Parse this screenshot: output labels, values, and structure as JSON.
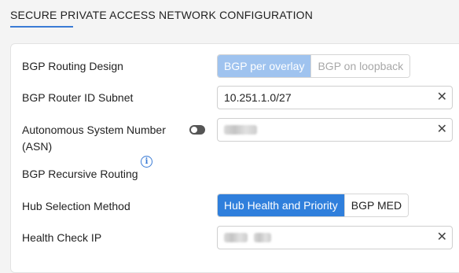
{
  "header": {
    "title": "SECURE PRIVATE ACCESS NETWORK CONFIGURATION"
  },
  "form": {
    "bgp_routing_design": {
      "label": "BGP Routing Design",
      "options": [
        "BGP per overlay",
        "BGP on loopback"
      ],
      "selected": "BGP per overlay"
    },
    "bgp_router_id_subnet": {
      "label": "BGP Router ID Subnet",
      "value": "10.251.1.0/27"
    },
    "asn": {
      "label": "Autonomous System Number (ASN)",
      "value_redacted": true
    },
    "bgp_recursive_routing": {
      "label": "BGP Recursive Routing",
      "enabled": false
    },
    "hub_selection_method": {
      "label": "Hub Selection Method",
      "options": [
        "Hub Health and Priority",
        "BGP MED"
      ],
      "selected": "Hub Health and Priority"
    },
    "health_check_ip": {
      "label": "Health Check IP",
      "value_redacted": true
    }
  },
  "icons": {
    "clear": "close-icon",
    "info": "info-icon",
    "toggle": "toggle-switch"
  },
  "colors": {
    "accent": "#2f7fdc",
    "accent_light": "#9fc3ef"
  }
}
